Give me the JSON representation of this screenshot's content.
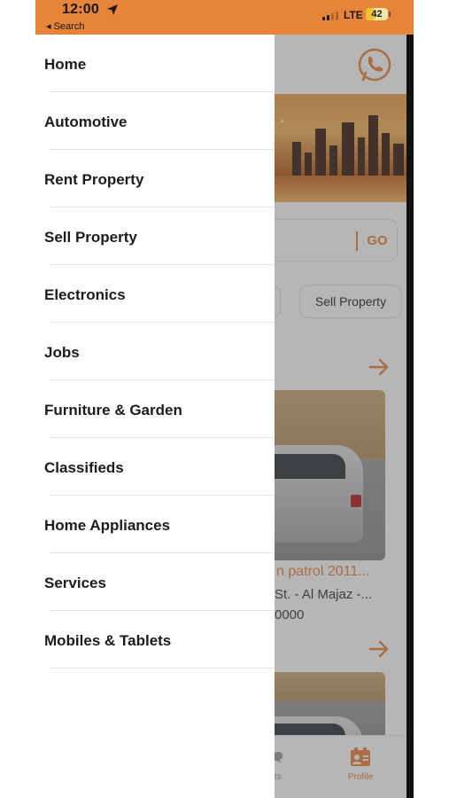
{
  "status_bar": {
    "time": "12:00",
    "back_label": "◂ Search",
    "network": "LTE",
    "battery": "42",
    "battery_level": 0.42
  },
  "drawer": {
    "items": [
      {
        "label": "Home"
      },
      {
        "label": "Automotive"
      },
      {
        "label": "Rent Property"
      },
      {
        "label": "Sell Property"
      },
      {
        "label": "Electronics"
      },
      {
        "label": "Jobs"
      },
      {
        "label": "Furniture & Garden"
      },
      {
        "label": "Classifieds"
      },
      {
        "label": "Home Appliances"
      },
      {
        "label": "Services"
      },
      {
        "label": "Mobiles & Tablets"
      }
    ]
  },
  "background": {
    "search_go": "GO",
    "chip_right": "Sell Property",
    "listing_title": "n patrol 2011...",
    "listing_location": "St. - Al Majaz -...",
    "listing_price": "0000",
    "tab_partial_label": "ts",
    "tab_profile_label": "Profile"
  },
  "colors": {
    "accent": "#e8833a",
    "status_bar": "#e8833a"
  },
  "icons": {
    "location": "location-arrow-icon",
    "whatsapp": "whatsapp-icon",
    "arrow": "arrow-right-icon",
    "profile": "profile-icon"
  }
}
